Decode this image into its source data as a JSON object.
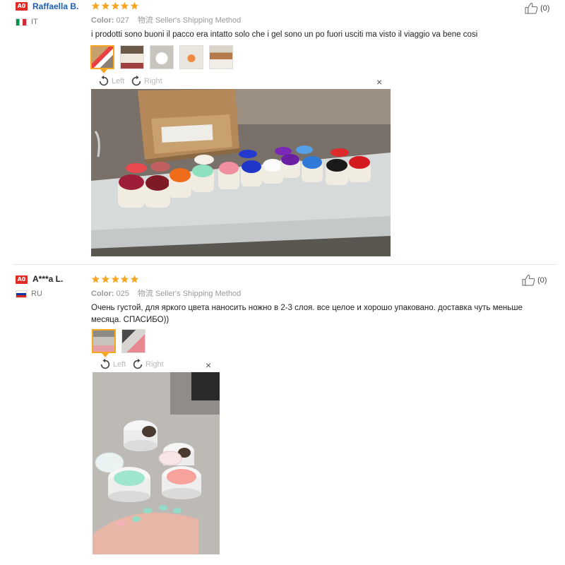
{
  "reviews": [
    {
      "badge": "A0",
      "username": "Raffaella B.",
      "country": "IT",
      "stars": 5,
      "color_label": "Color:",
      "color_value": "027",
      "shipping_cn": "物流",
      "shipping_method": "Seller's Shipping Method",
      "text": "i prodotti sono buoni il pacco era intatto solo che i gel sono un po fuori usciti ma visto il viaggio va bene cosi",
      "thumbnail_count": 5,
      "rotate_left": "Left",
      "rotate_right": "Right",
      "close": "×",
      "likes": "(0)"
    },
    {
      "badge": "A0",
      "username": "A***a L.",
      "country": "RU",
      "stars": 5,
      "color_label": "Color:",
      "color_value": "025",
      "shipping_cn": "物流",
      "shipping_method": "Seller's Shipping Method",
      "text_line1": "Очень густой, для яркого цвета наносить ножно в 2-3 слоя. все целое и хорошо упаковано. доставка чуть меньше",
      "text_line2": "месяца. СПАСИБО))",
      "thumbnail_count": 2,
      "rotate_left": "Left",
      "rotate_right": "Right",
      "close": "×",
      "likes": "(0)"
    }
  ],
  "colors": {
    "badge": "#e02b27",
    "star": "#f5a623",
    "username_link": "#1a5fb4",
    "selected_thumb_border": "#f5a623"
  }
}
